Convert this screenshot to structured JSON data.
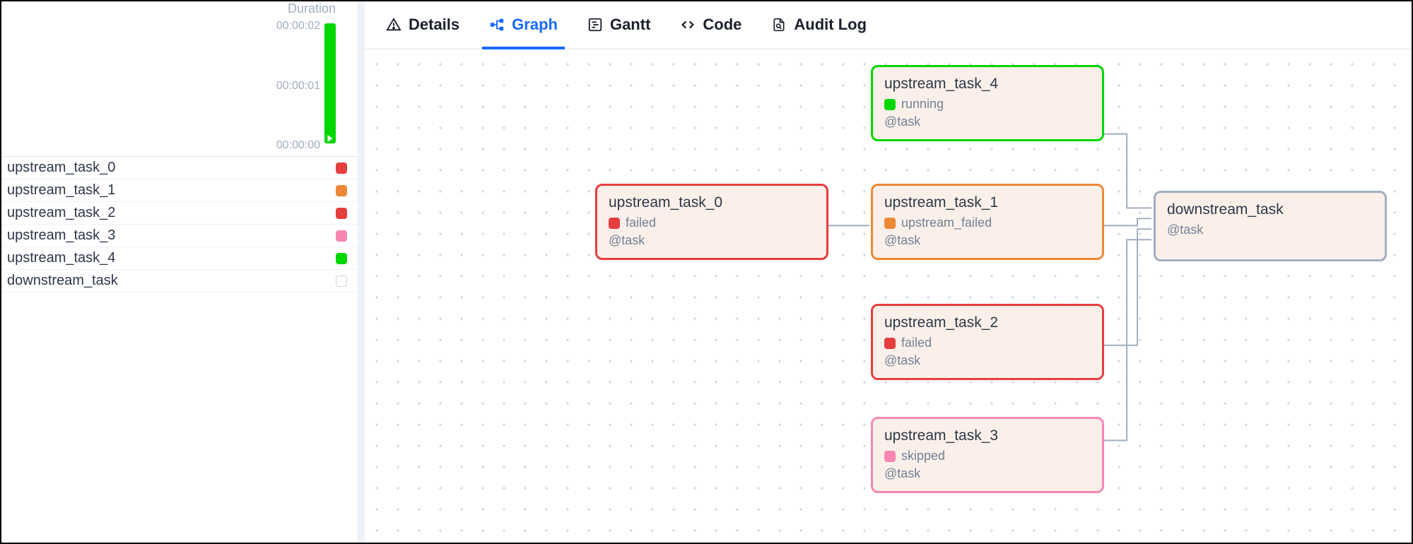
{
  "sidebar": {
    "duration_label": "Duration",
    "ticks": {
      "t0": "00:00:00",
      "t1": "00:00:01",
      "t2": "00:00:02"
    },
    "tasks": [
      {
        "name": "upstream_task_0",
        "color": "red"
      },
      {
        "name": "upstream_task_1",
        "color": "orange"
      },
      {
        "name": "upstream_task_2",
        "color": "red"
      },
      {
        "name": "upstream_task_3",
        "color": "pink"
      },
      {
        "name": "upstream_task_4",
        "color": "green"
      },
      {
        "name": "downstream_task",
        "color": "none"
      }
    ]
  },
  "tabs": {
    "details": "Details",
    "graph": "Graph",
    "gantt": "Gantt",
    "code": "Code",
    "audit": "Audit Log",
    "active": "graph"
  },
  "nodes": {
    "u0": {
      "title": "upstream_task_0",
      "status": "failed",
      "decor": "@task",
      "border": "b-red",
      "dot": "d-red"
    },
    "u1": {
      "title": "upstream_task_1",
      "status": "upstream_failed",
      "decor": "@task",
      "border": "b-orange",
      "dot": "d-orange"
    },
    "u2": {
      "title": "upstream_task_2",
      "status": "failed",
      "decor": "@task",
      "border": "b-red",
      "dot": "d-red"
    },
    "u3": {
      "title": "upstream_task_3",
      "status": "skipped",
      "decor": "@task",
      "border": "b-pink",
      "dot": "d-pink"
    },
    "u4": {
      "title": "upstream_task_4",
      "status": "running",
      "decor": "@task",
      "border": "b-green",
      "dot": "d-green"
    },
    "dn": {
      "title": "downstream_task",
      "status": "",
      "decor": "@task",
      "border": "b-grey",
      "dot": ""
    }
  },
  "colors": {
    "failed": "#e53e3e",
    "upstream_failed": "#ed8936",
    "running": "#00d600",
    "skipped": "#f687b3",
    "none": "#a0aec0",
    "accent": "#1869ff"
  }
}
